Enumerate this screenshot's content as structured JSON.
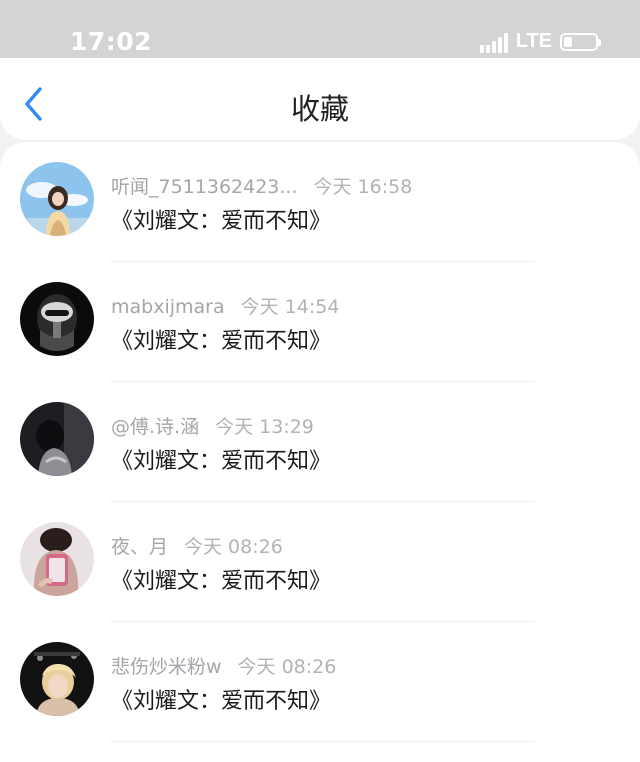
{
  "status_bar": {
    "time": "17:02",
    "network": "LTE",
    "icons": [
      "signal-icon",
      "battery-icon"
    ]
  },
  "nav": {
    "title": "收藏",
    "back_icon": "chevron-left-icon",
    "accent_color": "#2e8cf0"
  },
  "favorites": [
    {
      "user": "听闻_7511362423...",
      "time": "今天 16:58",
      "title": "《刘耀文：爱而不知》"
    },
    {
      "user": "mabxijmara",
      "time": "今天 14:54",
      "title": "《刘耀文：爱而不知》"
    },
    {
      "user": "@傅.诗.涵",
      "time": "今天 13:29",
      "title": "《刘耀文：爱而不知》"
    },
    {
      "user": "夜、月",
      "time": "今天 08:26",
      "title": "《刘耀文：爱而不知》"
    },
    {
      "user": "悲伤炒米粉w",
      "time": "今天 08:26",
      "title": "《刘耀文：爱而不知》"
    }
  ]
}
